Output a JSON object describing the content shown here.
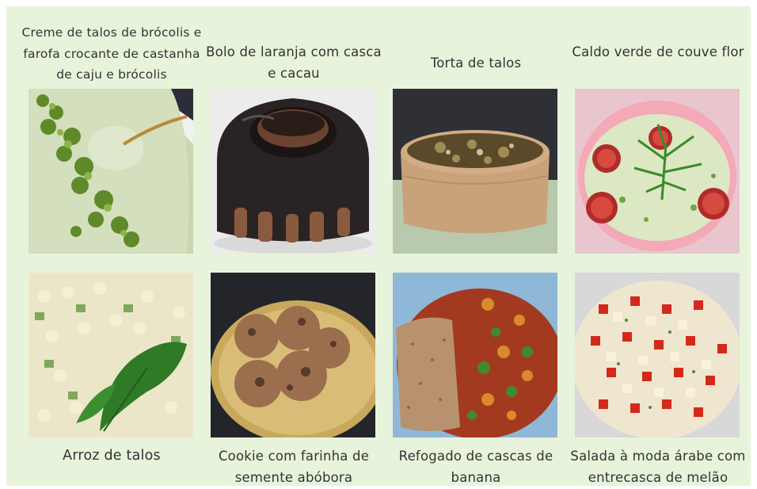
{
  "dishes": [
    {
      "caption": "Creme de talos de brócolis e farofa crocante de castanha de caju e brócolis",
      "photo_icon": "broccoli-cream-soup-photo"
    },
    {
      "caption": "Bolo de laranja com casca e cacau",
      "photo_icon": "chocolate-bundt-cake-photo"
    },
    {
      "caption": "Torta de talos",
      "photo_icon": "stem-pie-photo"
    },
    {
      "caption": "Caldo verde de couve flor",
      "photo_icon": "cauliflower-green-broth-photo"
    },
    {
      "caption": "Arroz de talos",
      "photo_icon": "stem-rice-photo"
    },
    {
      "caption": "Cookie com farinha de semente abóbora",
      "photo_icon": "pumpkin-seed-cookie-photo"
    },
    {
      "caption": "Refogado de cascas de banana",
      "photo_icon": "banana-peel-saute-photo"
    },
    {
      "caption": "Salada à moda árabe com entrecasca de melão",
      "photo_icon": "arab-style-melon-salad-photo"
    }
  ],
  "colors": {
    "panel_background": "#e8f3dc",
    "caption_text": "#333333"
  }
}
